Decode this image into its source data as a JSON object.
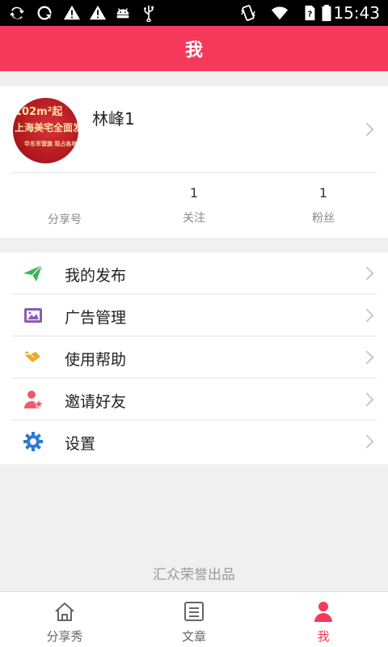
{
  "status_bar": {
    "time": "15:43",
    "icons": [
      "sync-icon",
      "sync-alt-icon",
      "warning-icon",
      "warning-icon",
      "android-icon",
      "usb-icon",
      "vibrate-icon",
      "wifi-icon",
      "sim-unknown-icon",
      "battery-icon"
    ]
  },
  "header": {
    "title": "我"
  },
  "profile": {
    "avatar_text": [
      "102m²起",
      "上海美宅全面发",
      "华东军营旗 现占各地特"
    ],
    "username": "林峰1",
    "stats": [
      {
        "label": "分享号",
        "value": ""
      },
      {
        "label": "关注",
        "value": "1"
      },
      {
        "label": "粉丝",
        "value": "1"
      }
    ]
  },
  "menu": [
    {
      "label": "我的发布",
      "icon": "paper-plane-icon",
      "color": "#3cb35a"
    },
    {
      "label": "广告管理",
      "icon": "ad-image-icon",
      "color": "#8a5bb5"
    },
    {
      "label": "使用帮助",
      "icon": "handshake-icon",
      "color": "#f2a623"
    },
    {
      "label": "邀请好友",
      "icon": "user-star-icon",
      "color": "#ee5a6a"
    },
    {
      "label": "设置",
      "icon": "gear-icon",
      "color": "#2f7bd1"
    }
  ],
  "footer": {
    "credit": "汇众荣誉出品"
  },
  "tabs": [
    {
      "label": "分享秀",
      "icon": "home-icon",
      "active": false
    },
    {
      "label": "文章",
      "icon": "article-icon",
      "active": false
    },
    {
      "label": "我",
      "icon": "person-icon",
      "active": true
    }
  ],
  "colors": {
    "accent": "#f5395a",
    "background": "#f0f0f0"
  }
}
